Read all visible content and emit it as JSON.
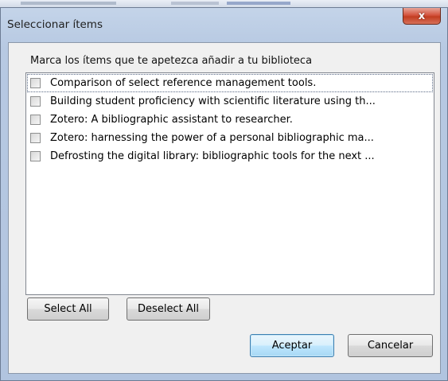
{
  "dialog": {
    "title": "Seleccionar ítems",
    "close_label": "x",
    "instruction": "Marca los ítems que te apetezca añadir a tu biblioteca",
    "items": [
      {
        "label": "Comparison of select reference management tools.",
        "checked": false
      },
      {
        "label": "Building student proficiency with scientific literature using th...",
        "checked": false
      },
      {
        "label": "Zotero: A bibliographic assistant to researcher.",
        "checked": false
      },
      {
        "label": "Zotero: harnessing the power of a personal bibliographic ma...",
        "checked": false
      },
      {
        "label": "Defrosting the digital library: bibliographic tools for the next ...",
        "checked": false
      }
    ],
    "buttons": {
      "select_all": "Select All",
      "deselect_all": "Deselect All",
      "accept": "Aceptar",
      "cancel": "Cancelar"
    }
  }
}
